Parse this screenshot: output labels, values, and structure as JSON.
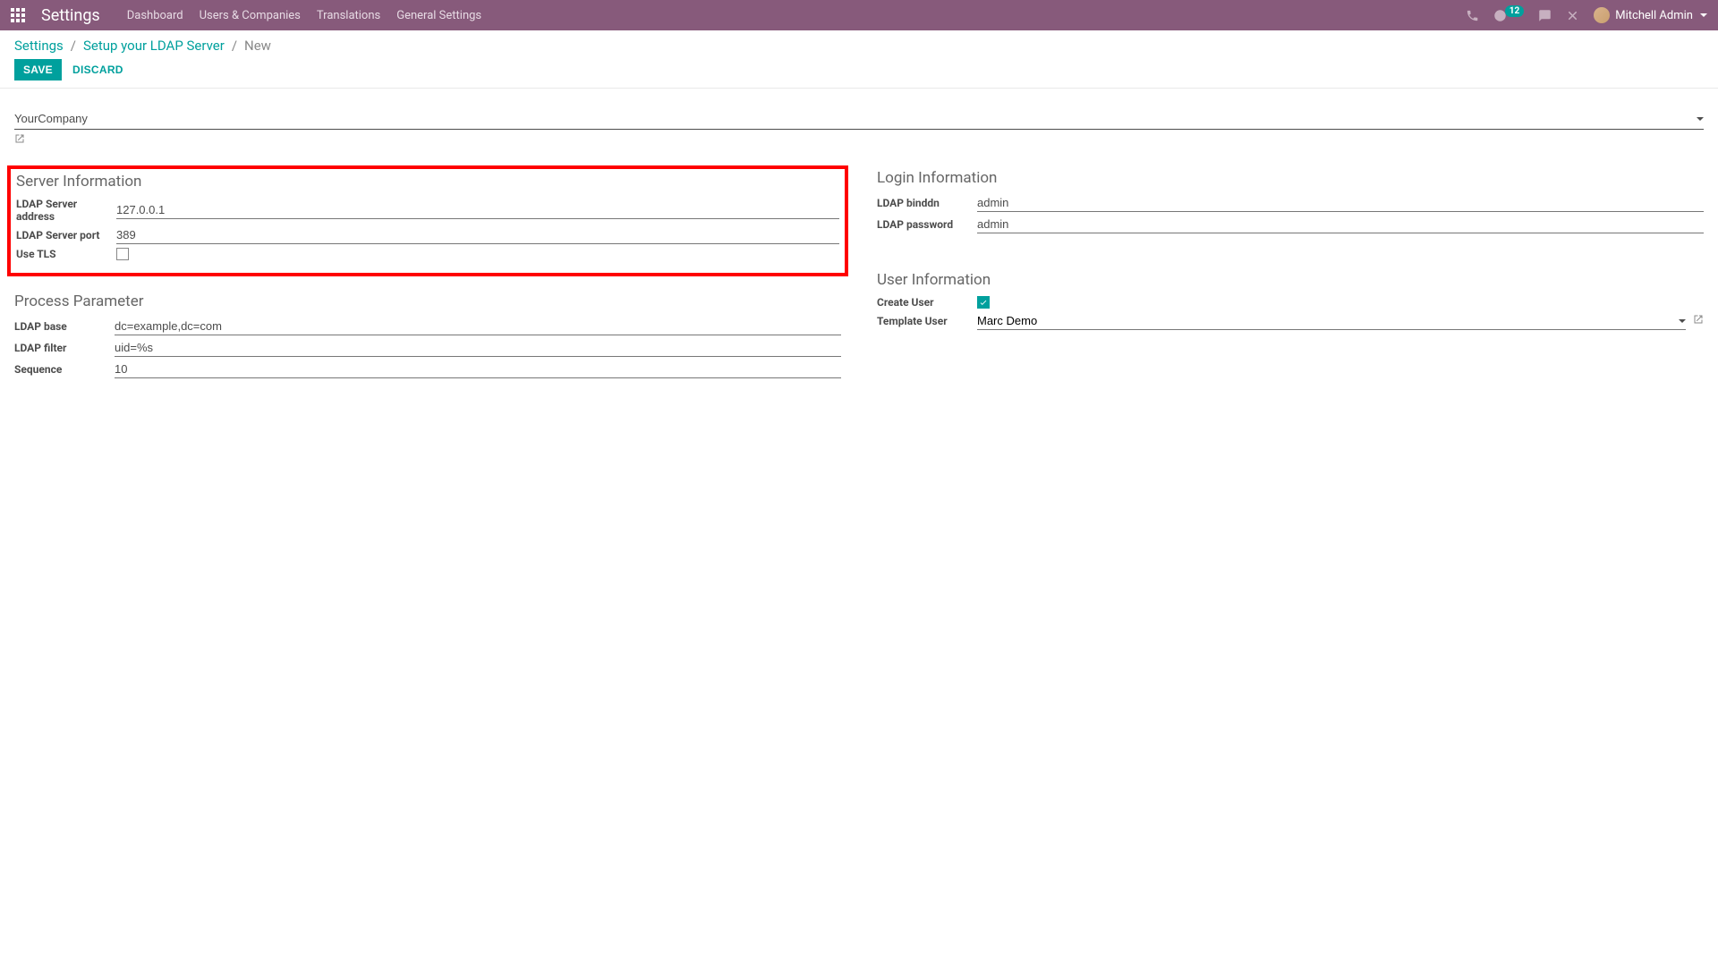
{
  "navbar": {
    "brand": "Settings",
    "links": [
      "Dashboard",
      "Users & Companies",
      "Translations",
      "General Settings"
    ],
    "badge_count": "12",
    "user_name": "Mitchell Admin"
  },
  "breadcrumb": {
    "root": "Settings",
    "parent": "Setup your LDAP Server",
    "current": "New"
  },
  "buttons": {
    "save": "SAVE",
    "discard": "DISCARD"
  },
  "company": {
    "value": "YourCompany"
  },
  "sections": {
    "server_info": {
      "title": "Server Information",
      "fields": {
        "address_label": "LDAP Server address",
        "address_value": "127.0.0.1",
        "port_label": "LDAP Server port",
        "port_value": "389",
        "tls_label": "Use TLS"
      }
    },
    "login_info": {
      "title": "Login Information",
      "fields": {
        "binddn_label": "LDAP binddn",
        "binddn_value": "admin",
        "password_label": "LDAP password",
        "password_value": "admin"
      }
    },
    "process_param": {
      "title": "Process Parameter",
      "fields": {
        "base_label": "LDAP base",
        "base_value": "dc=example,dc=com",
        "filter_label": "LDAP filter",
        "filter_value": "uid=%s",
        "sequence_label": "Sequence",
        "sequence_value": "10"
      }
    },
    "user_info": {
      "title": "User Information",
      "fields": {
        "create_user_label": "Create User",
        "template_user_label": "Template User",
        "template_user_value": "Marc Demo"
      }
    }
  }
}
